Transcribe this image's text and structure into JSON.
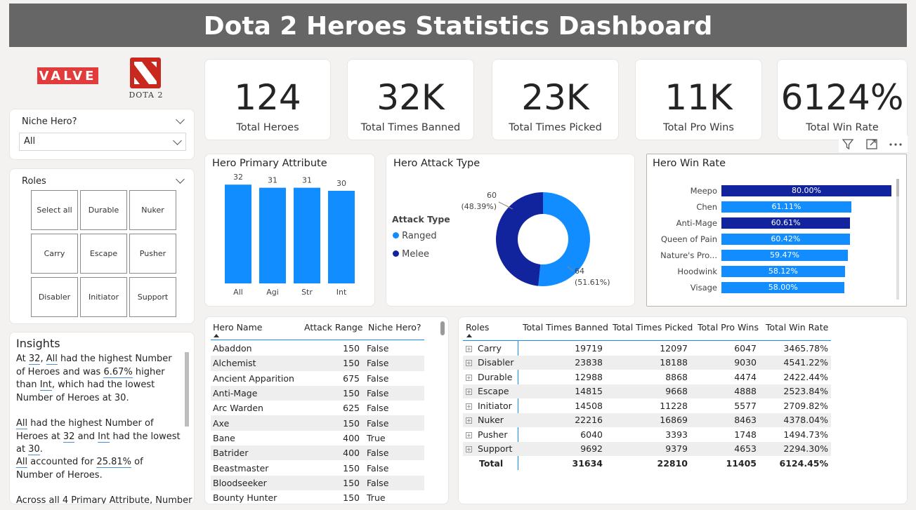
{
  "header": {
    "title": "Dota 2 Heroes Statistics Dashboard"
  },
  "logos": {
    "valve": "VALVE",
    "dota": "DOTA 2"
  },
  "niche_slicer": {
    "title": "Niche Hero?",
    "selected": "All"
  },
  "roles_slicer": {
    "title": "Roles",
    "options": [
      "Select all",
      "Durable",
      "Nuker",
      "Carry",
      "Escape",
      "Pusher",
      "Disabler",
      "Initiator",
      "Support"
    ]
  },
  "insights": {
    "title": "Insights",
    "p1": {
      "a": "At ",
      "v1": "32",
      "b": ", ",
      "v2": "All",
      "c": " had the highest Number of Heroes and was ",
      "v3": "6.67%",
      "d": " higher than ",
      "v4": "Int",
      "e": ", which had the lowest Number of Heroes at ",
      "v5": "30",
      "f": "."
    },
    "p2": {
      "v1": "All",
      "a": " had the highest Number of Heroes at ",
      "v2": "32",
      "b": " and ",
      "v3": "Int",
      "c": " had the lowest at ",
      "v4": "30",
      "d": "."
    },
    "p3": {
      "v1": "All",
      "a": " accounted for ",
      "v2": "25.81%",
      "b": " of Number of Heroes."
    },
    "p4": "Across all 4 Primary Attribute, Number"
  },
  "kpis": [
    {
      "value": "124",
      "label": "Total Heroes"
    },
    {
      "value": "32K",
      "label": "Total Times Banned"
    },
    {
      "value": "23K",
      "label": "Total Times Picked"
    },
    {
      "value": "11K",
      "label": "Total Pro Wins"
    },
    {
      "value": "6124%",
      "label": "Total Win Rate"
    }
  ],
  "chart_data": [
    {
      "type": "bar",
      "title": "Hero Primary Attribute",
      "categories": [
        "All",
        "Agi",
        "Str",
        "Int"
      ],
      "values": [
        32,
        31,
        31,
        30
      ],
      "ylim": [
        0,
        35
      ],
      "color": "#118dff"
    },
    {
      "type": "pie",
      "title": "Hero Attack Type",
      "legend_title": "Attack Type",
      "series": [
        {
          "name": "Ranged",
          "value": 64,
          "pct": "(51.61%)",
          "color": "#118dff"
        },
        {
          "name": "Melee",
          "value": 60,
          "pct": "(48.39%)",
          "color": "#12239e"
        }
      ]
    },
    {
      "type": "bar",
      "title": "Hero Win Rate",
      "orientation": "horizontal",
      "categories": [
        "Meepo",
        "Chen",
        "Anti-Mage",
        "Queen of Pain",
        "Nature's Pro...",
        "Hoodwink",
        "Visage"
      ],
      "values": [
        80.0,
        61.11,
        60.61,
        60.42,
        59.47,
        58.12,
        58.0
      ],
      "labels": [
        "80.00%",
        "61.11%",
        "60.61%",
        "60.42%",
        "59.47%",
        "58.12%",
        "58.00%"
      ],
      "highlight": [
        "Meepo",
        "Anti-Mage"
      ],
      "colors": {
        "normal": "#118dff",
        "highlight": "#12239e"
      }
    }
  ],
  "hero_table": {
    "columns": [
      "Hero Name",
      "Attack Range",
      "Niche Hero?"
    ],
    "rows": [
      [
        "Abaddon",
        "150",
        "False"
      ],
      [
        "Alchemist",
        "150",
        "False"
      ],
      [
        "Ancient Apparition",
        "675",
        "False"
      ],
      [
        "Anti-Mage",
        "150",
        "False"
      ],
      [
        "Arc Warden",
        "625",
        "False"
      ],
      [
        "Axe",
        "150",
        "False"
      ],
      [
        "Bane",
        "400",
        "True"
      ],
      [
        "Batrider",
        "400",
        "False"
      ],
      [
        "Beastmaster",
        "150",
        "False"
      ],
      [
        "Bloodseeker",
        "150",
        "False"
      ],
      [
        "Bounty Hunter",
        "150",
        "True"
      ]
    ]
  },
  "roles_table": {
    "columns": [
      "Roles",
      "Total Times Banned",
      "Total Times Picked",
      "Total Pro Wins",
      "Total Win Rate"
    ],
    "rows": [
      [
        "Carry",
        "19719",
        "12097",
        "6047",
        "3465.78%"
      ],
      [
        "Disabler",
        "23838",
        "18188",
        "9030",
        "4541.22%"
      ],
      [
        "Durable",
        "12988",
        "8868",
        "4474",
        "2422.44%"
      ],
      [
        "Escape",
        "14815",
        "9668",
        "4888",
        "2523.84%"
      ],
      [
        "Initiator",
        "14508",
        "11228",
        "5577",
        "2709.82%"
      ],
      [
        "Nuker",
        "22216",
        "16869",
        "8463",
        "4378.04%"
      ],
      [
        "Pusher",
        "6040",
        "3393",
        "1748",
        "1494.73%"
      ],
      [
        "Support",
        "9692",
        "9379",
        "4653",
        "2294.30%"
      ]
    ],
    "total": [
      "Total",
      "31634",
      "22810",
      "11405",
      "6124.45%"
    ]
  },
  "visual_toolbar": {
    "filter": "filter-icon",
    "focus": "focus-mode-icon",
    "more": "more-options-icon"
  }
}
